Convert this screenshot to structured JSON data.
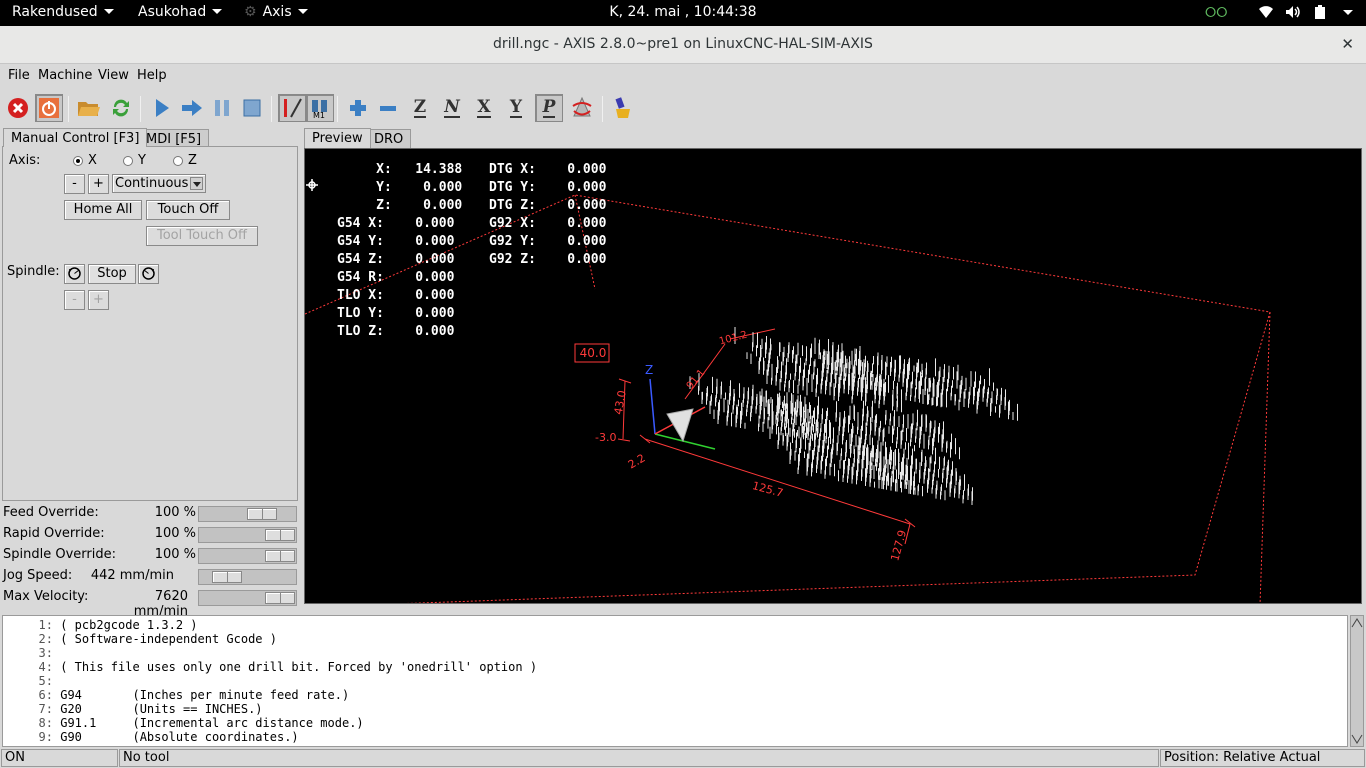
{
  "topbar": {
    "activities": "Rakendused",
    "places": "Asukohad",
    "app": "Axis",
    "clock": "K, 24. mai , 10:44:38"
  },
  "window": {
    "title": "drill.ngc - AXIS 2.8.0~pre1 on LinuxCNC-HAL-SIM-AXIS",
    "close": "✕"
  },
  "menu": {
    "file": "File",
    "machine": "Machine",
    "view": "View",
    "help": "Help"
  },
  "left_tabs": {
    "manual": "Manual Control [F3]",
    "mdi": "MDI [F5]"
  },
  "manual": {
    "axis_label": "Axis:",
    "axes": [
      "X",
      "Y",
      "Z"
    ],
    "selected_axis": "X",
    "minus": "-",
    "plus": "+",
    "jog_mode": "Continuous",
    "home_all": "Home All",
    "touch_off": "Touch Off",
    "tool_touch_off": "Tool Touch Off",
    "spindle_label": "Spindle:",
    "spindle_stop": "Stop",
    "spindle_minus": "-",
    "spindle_plus": "+"
  },
  "overrides": {
    "feed": {
      "label": "Feed Override:",
      "value": "100 %",
      "fraction": 0.72
    },
    "rapid": {
      "label": "Rapid Override:",
      "value": "100 %",
      "fraction": 1.0
    },
    "spindle": {
      "label": "Spindle Override:",
      "value": "100 %",
      "fraction": 1.0
    },
    "jog": {
      "label": "Jog Speed:",
      "value": "442 mm/min",
      "fraction": 0.18
    },
    "maxvel": {
      "label": "Max Velocity:",
      "value": "7620 mm/min",
      "fraction": 1.0
    }
  },
  "view_tabs": {
    "preview": "Preview",
    "dro": "DRO"
  },
  "dro": {
    "col1": [
      "     X:   14.388",
      "     Y:    0.000",
      "     Z:    0.000",
      "G54 X:    0.000",
      "G54 Y:    0.000",
      "G54 Z:    0.000",
      "G54 R:    0.000",
      "TLO X:    0.000",
      "TLO Y:    0.000",
      "TLO Z:    0.000"
    ],
    "col2": [
      "DTG X:    0.000",
      "DTG Y:    0.000",
      "DTG Z:    0.000",
      "G92 X:    0.000",
      "G92 Y:    0.000",
      "G92 Z:    0.000"
    ]
  },
  "preview_labels": {
    "z_height": "40.0",
    "z_axis": "Z",
    "dim_a": "43.0",
    "dim_b": "-3.0",
    "dim_c": "2.2",
    "dim_d": "125.7",
    "dim_e": "127.9",
    "dim_f": "91.1",
    "dim_g": "101.2"
  },
  "gcode": [
    {
      "n": "1:",
      "text": "( pcb2gcode 1.3.2 )"
    },
    {
      "n": "2:",
      "text": "( Software-independent Gcode )"
    },
    {
      "n": "3:",
      "text": ""
    },
    {
      "n": "4:",
      "text": "( This file uses only one drill bit. Forced by 'onedrill' option )"
    },
    {
      "n": "5:",
      "text": ""
    },
    {
      "n": "6:",
      "text": "G94       (Inches per minute feed rate.)"
    },
    {
      "n": "7:",
      "text": "G20       (Units == INCHES.)"
    },
    {
      "n": "8:",
      "text": "G91.1     (Incremental arc distance mode.)"
    },
    {
      "n": "9:",
      "text": "G90       (Absolute coordinates.)"
    }
  ],
  "status": {
    "state": "ON",
    "tool": "No tool",
    "position": "Position: Relative Actual"
  },
  "colors": {
    "accent_red": "#e03030",
    "toolpath_white": "#e8e8e8",
    "extents_red": "#ff3a3a"
  }
}
